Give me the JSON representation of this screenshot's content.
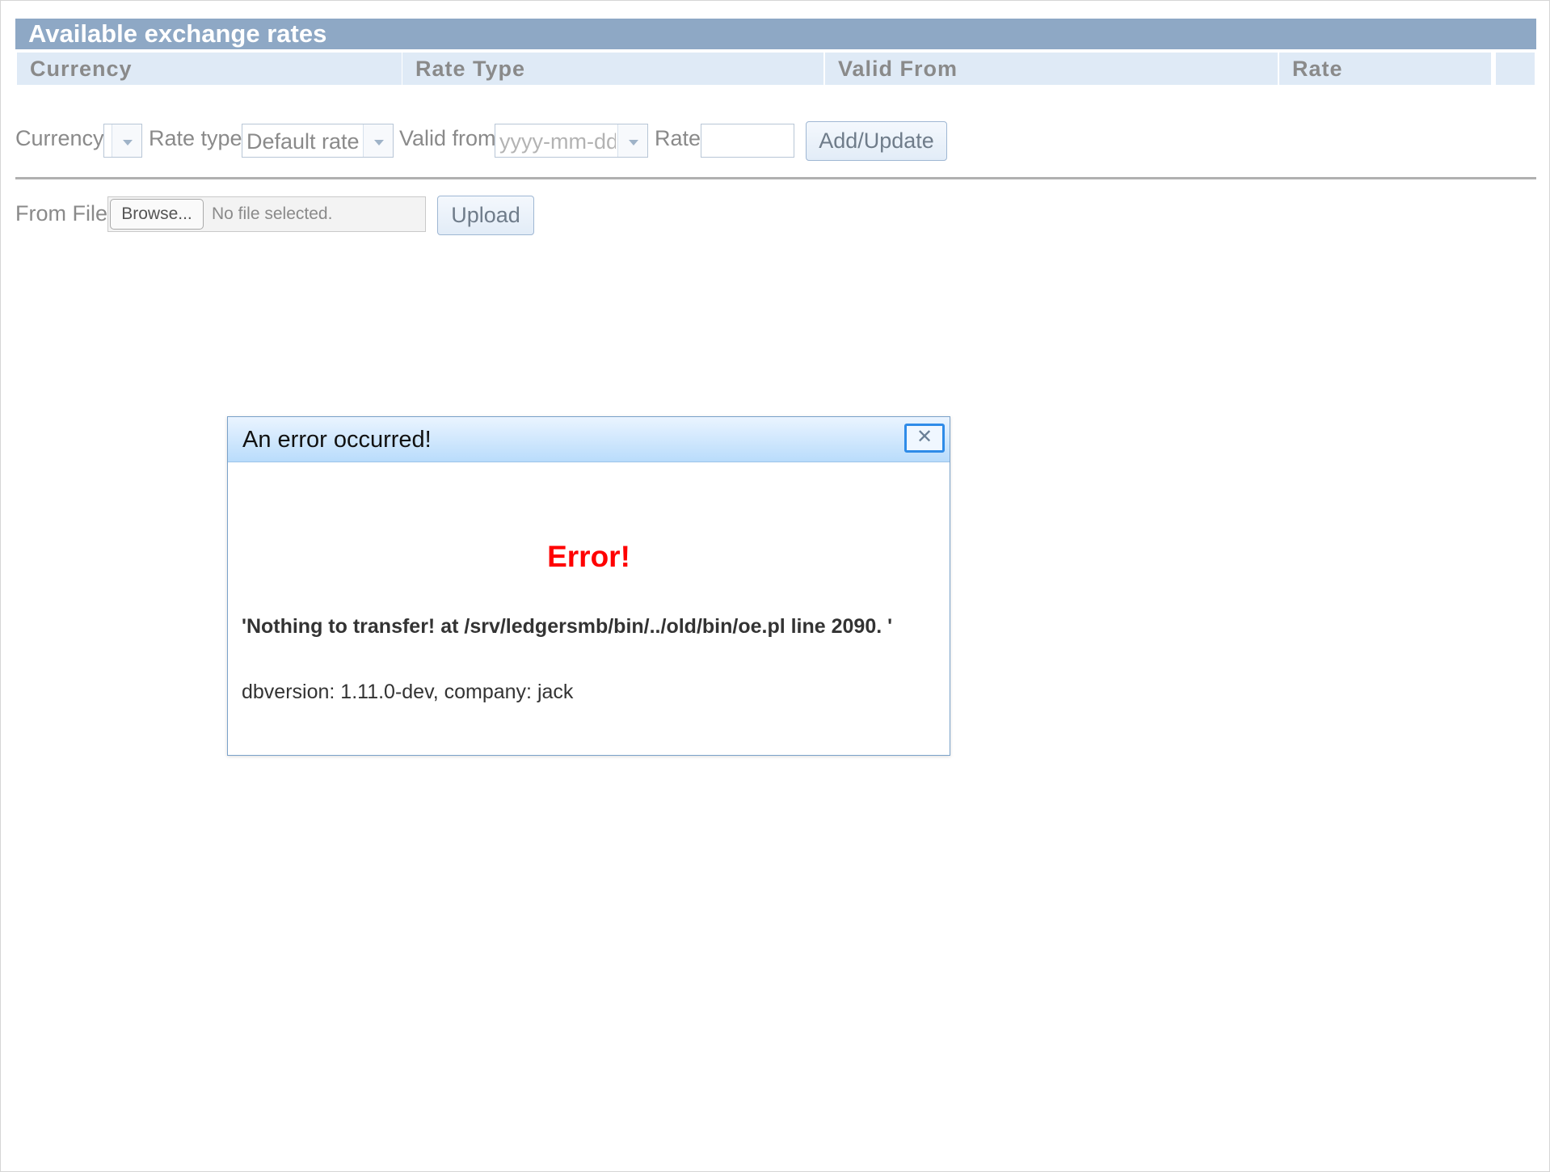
{
  "page": {
    "title": "Available exchange rates",
    "columns": [
      "Currency",
      "Rate Type",
      "Valid From",
      "Rate",
      ""
    ]
  },
  "form": {
    "currency_label": "Currency",
    "currency_value": "",
    "rate_type_label": "Rate type",
    "rate_type_value": "Default rate",
    "valid_from_label": "Valid from",
    "valid_from_placeholder": "yyyy-mm-dd",
    "rate_label": "Rate",
    "rate_value": "",
    "add_update_label": "Add/Update"
  },
  "file": {
    "label": "From File",
    "browse_label": "Browse...",
    "status": "No file selected.",
    "upload_label": "Upload"
  },
  "dialog": {
    "title": "An error occurred!",
    "close_glyph": "✕",
    "heading": "Error!",
    "message": "'Nothing to transfer! at /srv/ledgersmb/bin/../old/bin/oe.pl line 2090. '",
    "info": "dbversion: 1.11.0-dev, company: jack"
  },
  "colors": {
    "title_bar": "#8ea8c5",
    "header_cell": "#dfeaf6",
    "error_red": "#ff0000",
    "focus_blue": "#2e8be8"
  }
}
